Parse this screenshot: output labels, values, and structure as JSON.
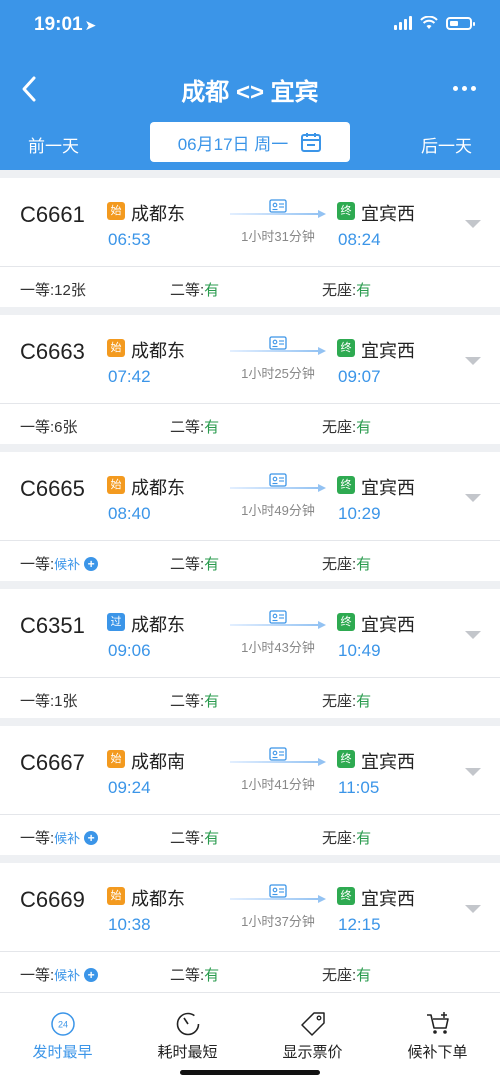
{
  "status": {
    "time": "19:01"
  },
  "header": {
    "title": "成都 <> 宜宾",
    "prev_day": "前一天",
    "next_day": "后一天",
    "date": "06月17日 周一"
  },
  "colors": {
    "brand": "#3b95e8",
    "available": "#2a9b4e",
    "badge_orange": "#f39a1f",
    "badge_green": "#2eaa51",
    "badge_blue": "#3b95e8"
  },
  "trains": [
    {
      "no": "C6661",
      "dep_badge": "始",
      "dep_badge_color": "#f39a1f",
      "dep_station": "成都东",
      "dep_time": "06:53",
      "arr_badge": "终",
      "arr_badge_color": "#2eaa51",
      "arr_station": "宜宾西",
      "arr_time": "08:24",
      "duration": "1小时31分钟",
      "seat1_label": "一等:",
      "seat1_value": "12张",
      "seat2_label": "二等:",
      "seat2_value": "有",
      "seat3_label": "无座:",
      "seat3_value": "有"
    },
    {
      "no": "C6663",
      "dep_badge": "始",
      "dep_badge_color": "#f39a1f",
      "dep_station": "成都东",
      "dep_time": "07:42",
      "arr_badge": "终",
      "arr_badge_color": "#2eaa51",
      "arr_station": "宜宾西",
      "arr_time": "09:07",
      "duration": "1小时25分钟",
      "seat1_label": "一等:",
      "seat1_value": "6张",
      "seat2_label": "二等:",
      "seat2_value": "有",
      "seat3_label": "无座:",
      "seat3_value": "有"
    },
    {
      "no": "C6665",
      "dep_badge": "始",
      "dep_badge_color": "#f39a1f",
      "dep_station": "成都东",
      "dep_time": "08:40",
      "arr_badge": "终",
      "arr_badge_color": "#2eaa51",
      "arr_station": "宜宾西",
      "arr_time": "10:29",
      "duration": "1小时49分钟",
      "seat1_label": "一等:",
      "seat1_value": "候补",
      "seat2_label": "二等:",
      "seat2_value": "有",
      "seat3_label": "无座:",
      "seat3_value": "有"
    },
    {
      "no": "C6351",
      "dep_badge": "过",
      "dep_badge_color": "#3b95e8",
      "dep_station": "成都东",
      "dep_time": "09:06",
      "arr_badge": "终",
      "arr_badge_color": "#2eaa51",
      "arr_station": "宜宾西",
      "arr_time": "10:49",
      "duration": "1小时43分钟",
      "seat1_label": "一等:",
      "seat1_value": "1张",
      "seat2_label": "二等:",
      "seat2_value": "有",
      "seat3_label": "无座:",
      "seat3_value": "有"
    },
    {
      "no": "C6667",
      "dep_badge": "始",
      "dep_badge_color": "#f39a1f",
      "dep_station": "成都南",
      "dep_time": "09:24",
      "arr_badge": "终",
      "arr_badge_color": "#2eaa51",
      "arr_station": "宜宾西",
      "arr_time": "11:05",
      "duration": "1小时41分钟",
      "seat1_label": "一等:",
      "seat1_value": "候补",
      "seat2_label": "二等:",
      "seat2_value": "有",
      "seat3_label": "无座:",
      "seat3_value": "有"
    },
    {
      "no": "C6669",
      "dep_badge": "始",
      "dep_badge_color": "#f39a1f",
      "dep_station": "成都东",
      "dep_time": "10:38",
      "arr_badge": "终",
      "arr_badge_color": "#2eaa51",
      "arr_station": "宜宾西",
      "arr_time": "12:15",
      "duration": "1小时37分钟",
      "seat1_label": "一等:",
      "seat1_value": "候补",
      "seat2_label": "二等:",
      "seat2_value": "有",
      "seat3_label": "无座:",
      "seat3_value": "有"
    }
  ],
  "bottom_bar": {
    "sort_departure": "发时最早",
    "sort_departure_icon_text": "24",
    "sort_duration": "耗时最短",
    "show_price": "显示票价",
    "waitlist_order": "候补下单"
  }
}
